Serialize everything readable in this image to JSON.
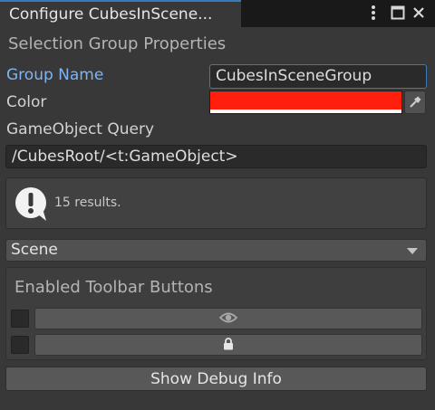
{
  "window": {
    "tab_title": "Configure CubesInScene...",
    "icons": [
      "more-vertical-icon",
      "maximize-icon",
      "close-icon"
    ]
  },
  "panel": {
    "section_title": "Selection Group Properties",
    "group_name": {
      "label": "Group Name",
      "value": "CubesInSceneGroup"
    },
    "color": {
      "label": "Color",
      "value": "#ff1f0c",
      "picker_icon": "eyedropper-icon"
    },
    "query": {
      "label": "GameObject Query",
      "value": "/CubesRoot/<t:GameObject>"
    },
    "results": {
      "icon": "info-bubble-icon",
      "text": "15 results."
    },
    "search_scope": {
      "selected": "Scene"
    },
    "toolbar_buttons": {
      "title": "Enabled Toolbar Buttons",
      "items": [
        {
          "icon": "eye-icon",
          "checked": false
        },
        {
          "icon": "lock-icon",
          "checked": false
        }
      ]
    },
    "debug_button_label": "Show Debug Info"
  },
  "colors": {
    "accent": "#3a79bb",
    "focused_label": "#7fb4f5",
    "background": "#383838"
  }
}
